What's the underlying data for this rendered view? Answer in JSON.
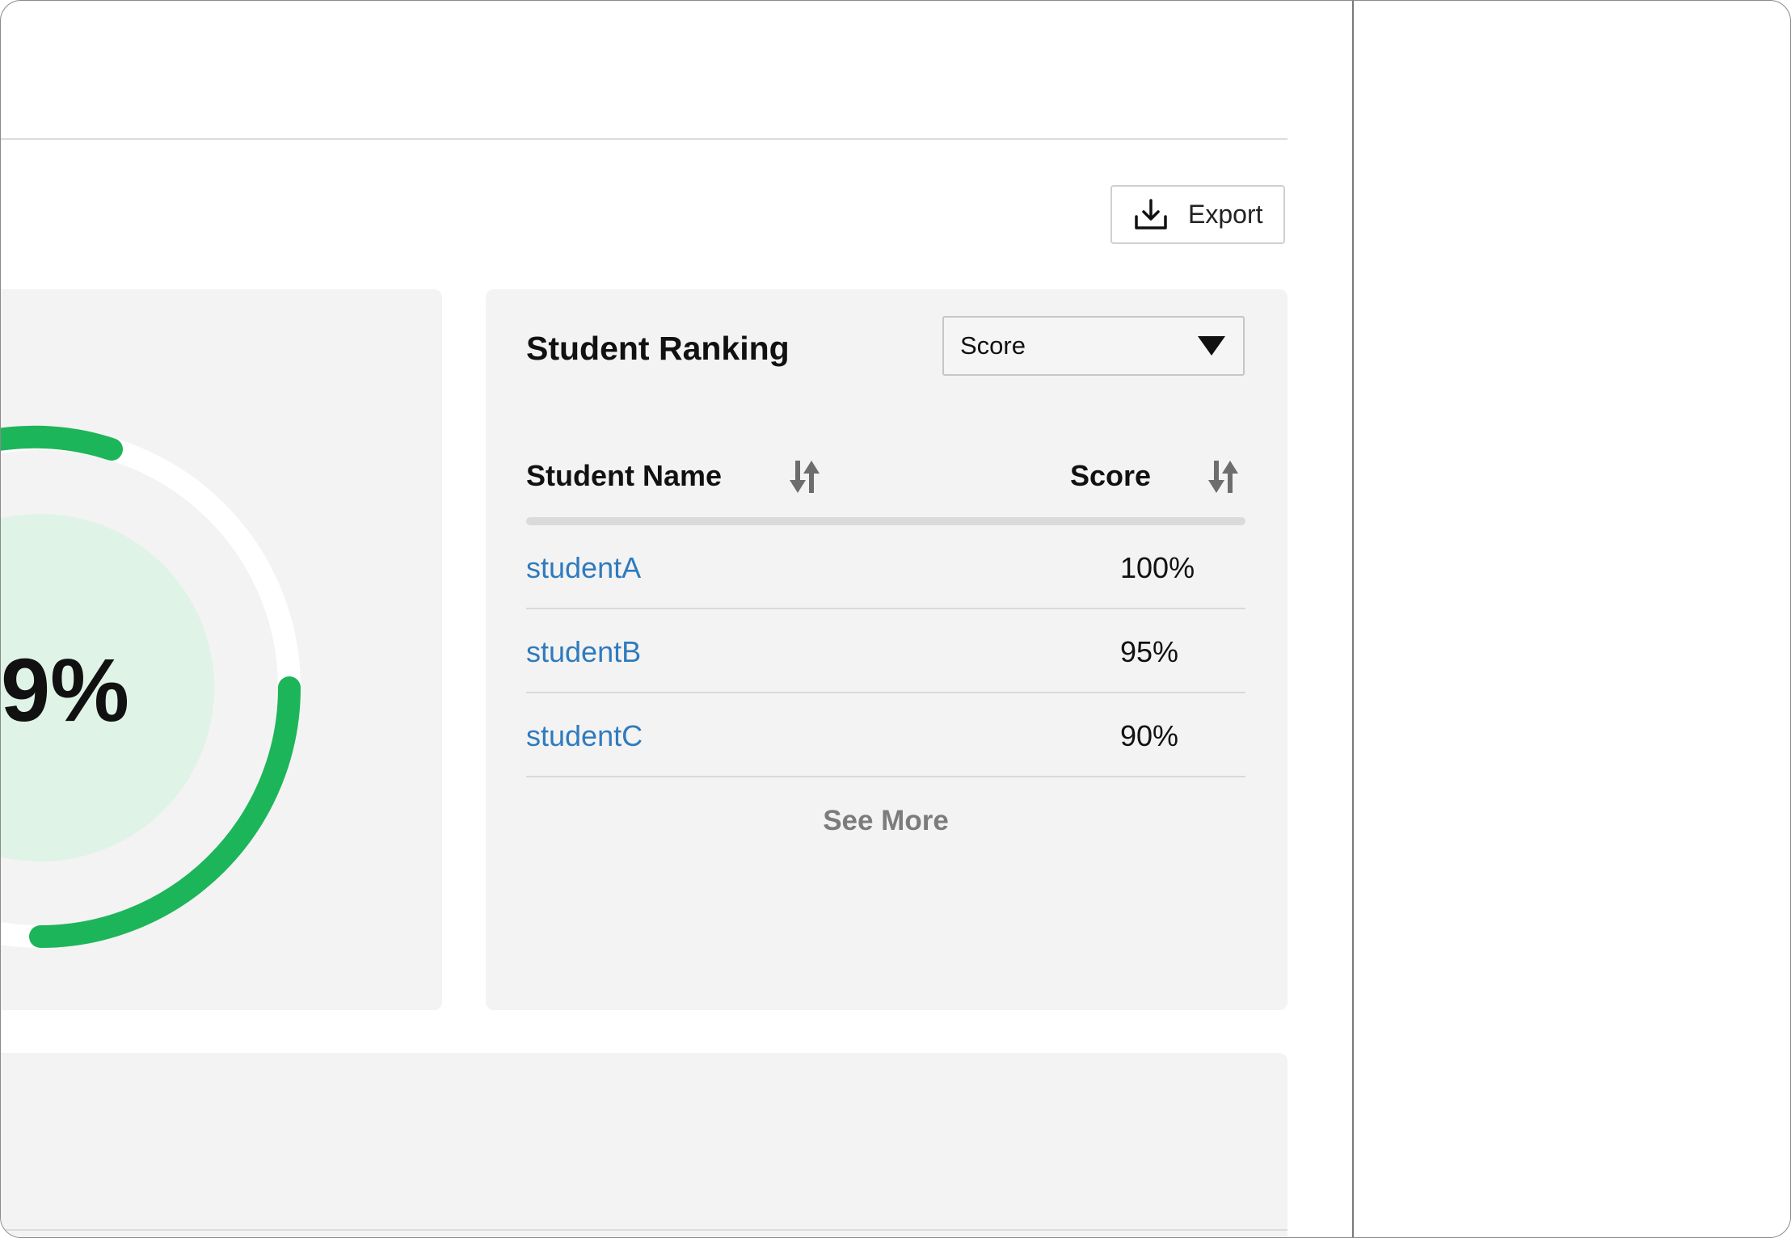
{
  "toolbar": {
    "export_label": "Export",
    "export_icon": "download-icon"
  },
  "summary": {
    "gauge_text": "9%",
    "gauge_accent": "#1db55a",
    "gauge_track": "#ffffff",
    "gauge_inner": "#dff3e7"
  },
  "ranking": {
    "title": "Student Ranking",
    "select_value": "Score",
    "columns": [
      {
        "label": "Student Name",
        "icon": "sort-icon"
      },
      {
        "label": "Score",
        "icon": "sort-icon"
      }
    ],
    "rows": [
      {
        "name": "studentA",
        "score": "100%"
      },
      {
        "name": "studentB",
        "score": "95%"
      },
      {
        "name": "studentC",
        "score": "90%"
      }
    ],
    "see_more": "See More",
    "link_color": "#2f7bbd"
  }
}
